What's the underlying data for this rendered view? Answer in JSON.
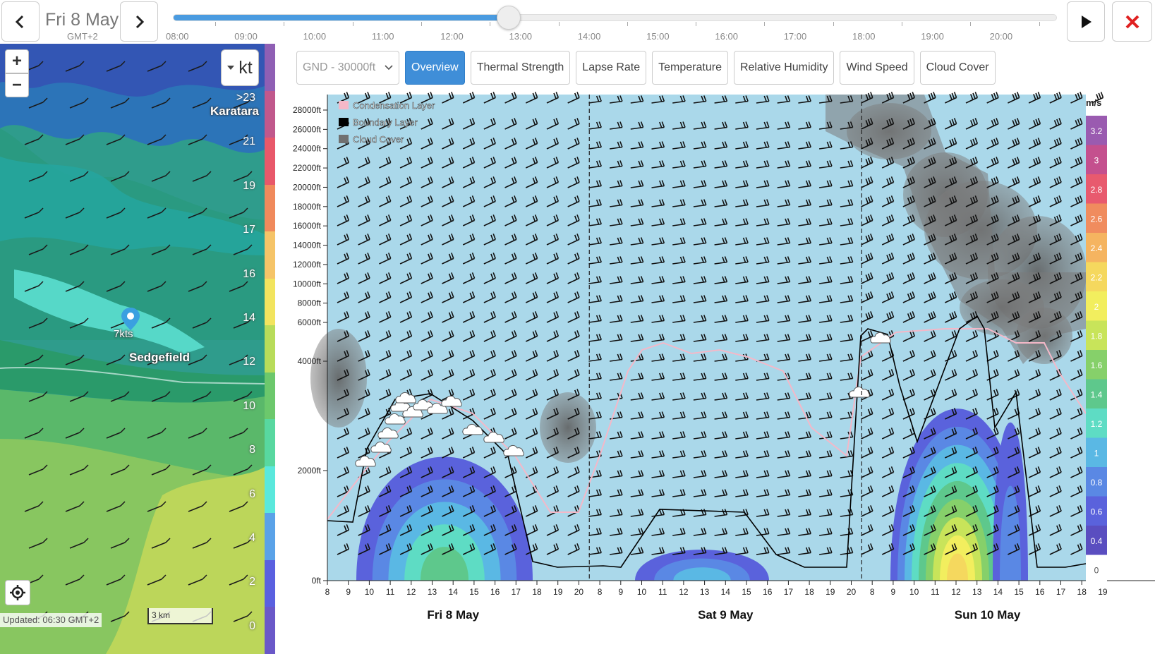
{
  "topbar": {
    "date": "Fri 8 May",
    "timezone": "GMT+2",
    "progress": 0.38,
    "hours": [
      "08:00",
      "09:00",
      "10:00",
      "11:00",
      "12:00",
      "13:00",
      "14:00",
      "15:00",
      "16:00",
      "17:00",
      "18:00",
      "19:00",
      "20:00"
    ]
  },
  "map": {
    "zoom_in": "+",
    "zoom_out": "−",
    "unit": "kt",
    "places": {
      "town1": "Karatara",
      "town2": "Sedgefield",
      "marker_value": "7kts"
    },
    "legend": [
      ">23",
      "21",
      "19",
      "17",
      "16",
      "14",
      "12",
      "10",
      "8",
      "6",
      "4",
      "2",
      "0"
    ],
    "legend_colors": [
      "#8f5fb4",
      "#c0588c",
      "#e8586a",
      "#f08a5c",
      "#f5c468",
      "#f2e45e",
      "#b8dc5a",
      "#6cc86c",
      "#58d8a0",
      "#5ae8dc",
      "#5aa2e8",
      "#5a60e0",
      "#6a58c8"
    ],
    "updated": "Updated: 06:30 GMT+2",
    "scale": "3 km"
  },
  "tabs": {
    "altitude": "GND - 30000ft",
    "items": [
      "Overview",
      "Thermal Strength",
      "Lapse Rate",
      "Temperature",
      "Relative Humidity",
      "Wind Speed",
      "Cloud Cover"
    ],
    "active": "Overview"
  },
  "chart_data": {
    "type": "heatmap",
    "legend": [
      {
        "name": "Condensation Layer",
        "color": "#f4b8c8"
      },
      {
        "name": "Boundary Layer",
        "color": "#000000"
      },
      {
        "name": "Cloud Cover",
        "color": "#707070"
      }
    ],
    "y_ticks": [
      "28000ft",
      "26000ft",
      "24000ft",
      "22000ft",
      "20000ft",
      "18000ft",
      "16000ft",
      "14000ft",
      "12000ft",
      "10000ft",
      "8000ft",
      "6000ft",
      "4000ft",
      "2000ft",
      "0ft"
    ],
    "days": [
      {
        "label": "Fri 8 May",
        "hours": [
          "8",
          "9",
          "10",
          "11",
          "12",
          "13",
          "14",
          "15",
          "16",
          "17",
          "18",
          "19",
          "20"
        ]
      },
      {
        "label": "Sat 9 May",
        "hours": [
          "8",
          "9",
          "10",
          "11",
          "12",
          "13",
          "14",
          "15",
          "16",
          "17",
          "18",
          "19",
          "20"
        ]
      },
      {
        "label": "Sun 10 May",
        "hours": [
          "8",
          "9",
          "10",
          "11",
          "12",
          "13",
          "14",
          "15",
          "16",
          "17",
          "18",
          "19"
        ]
      }
    ],
    "color_scale_unit": "m/s",
    "color_scale": [
      "3.2",
      "3",
      "2.8",
      "2.6",
      "2.4",
      "2.2",
      "2",
      "1.8",
      "1.6",
      "1.4",
      "1.2",
      "1",
      "0.8",
      "0.6",
      "0.4",
      "0"
    ],
    "color_scale_colors": [
      "#9a5bb0",
      "#c4508e",
      "#e85a6e",
      "#f08c5e",
      "#f5b460",
      "#f5d85e",
      "#f2ee5e",
      "#c8e45a",
      "#86d06a",
      "#5ec88c",
      "#5edcc4",
      "#5ab8e4",
      "#5a88e4",
      "#5a62dc",
      "#5a4ec0",
      "#ffffff"
    ]
  }
}
